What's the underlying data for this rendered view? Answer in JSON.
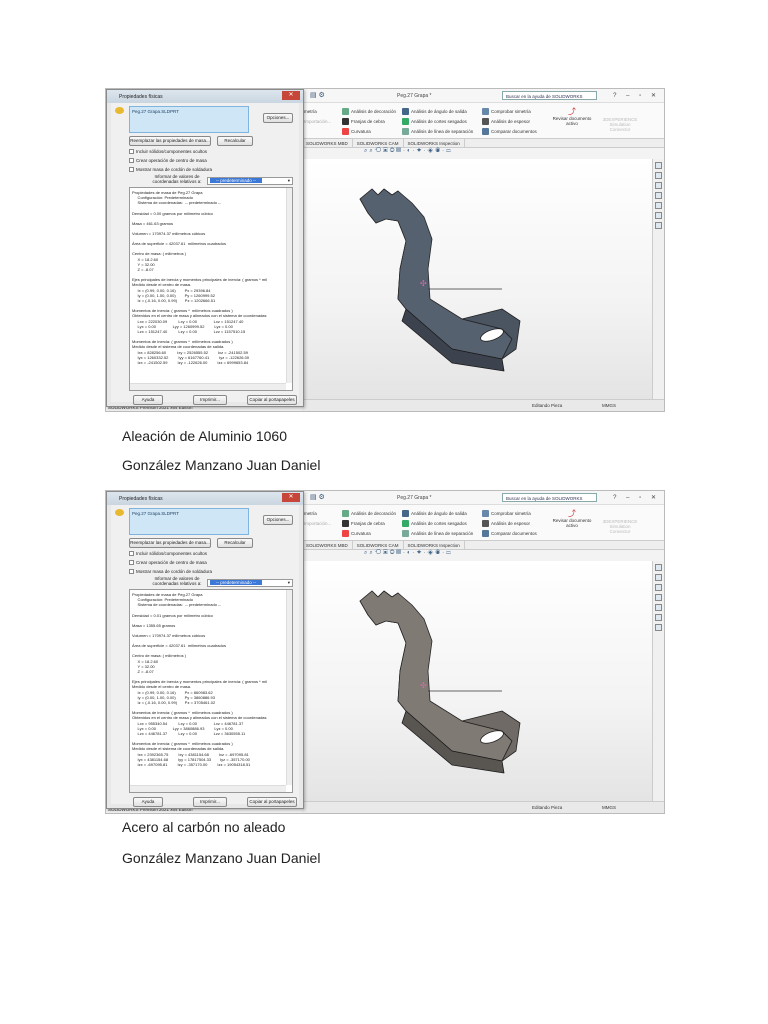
{
  "captions": [
    "Aleación de Aluminio  1060",
    "González Manzano Juan Daniel",
    "Acero al carbón no aleado",
    "González Manzano Juan Daniel"
  ],
  "common": {
    "dialog_title": "Propiedades físicas",
    "selection": "Peg.27 Grapa.SLDPRT",
    "options": "Opciones...",
    "override": "Reemplazar las propiedades de masa...",
    "recalc": "Recalcular",
    "chk_hidden": "Incluir sólidos/componentes ocultos",
    "chk_com": "Crear operación de centro de masa",
    "chk_weld": "Mostrar masa de cordón de soldadura",
    "coord_label": "Informar de valores de coordenadas relativos a:",
    "coord_value": "-- predeterminado --",
    "help": "Ayuda",
    "print": "Imprimir...",
    "copy": "Copiar al portapapeles",
    "doc_title": "Peg.27 Grapa *",
    "search": "Buscar en la ayuda de SOLIDWORKS",
    "ribbon": [
      [
        "Análisis de decoración",
        "Franjas de cebra",
        "Curvatura"
      ],
      [
        "Análisis de ángulo de salida",
        "Análisis de cortes sesgados",
        "Análisis de línea de separación"
      ],
      [
        "Comprobar simetría",
        "Análisis de espesor",
        "Comparar documentos"
      ]
    ],
    "ribbon_left": [
      "metría",
      "Importación..."
    ],
    "review": "Revisar documento activo",
    "simulation": "3DEXPERIENCE Simulation Connector",
    "tabs": [
      "SOLIDWORKS MBD",
      "SOLIDWORKS CAM",
      "SOLIDWORKS Inspection"
    ],
    "taskbar": "SOLIDWORKS Premium 2021 x64 Edition",
    "status_edit": "Editando Pieza",
    "status_units": "MMGS"
  },
  "shots": [
    {
      "report": [
        "Propiedades de masa de Peg.27 Grapa",
        "     Configuración: Predeterminado",
        "     Sistema de coordenadas:  -- predeterminado --",
        "",
        "Densidad = 0.00 gramos por milímetro cúbico",
        "",
        "Masa = 461.63 gramos",
        "",
        "Volumen = 170974.37 milímetros cúbicos",
        "",
        "Área de superficie = 42037.61  milímetros cuadrados",
        "",
        "Centro de masa: ( milímetros )",
        "     X = 18.2.60",
        "     Y = 32.00",
        "     Z = -8.07",
        "",
        "Ejes principales de inercia y momentos principales de inercia: ( gramos * mil",
        "Medido desde el centro de masa.",
        "     Ix = (0.99, 0.00, 0.16)        Px = 29396.84",
        "     Iy = (0.00, 1.00, 0.00)        Py = 1260999.52",
        "     Iz = (-0.16, 0.00, 0.99)       Pz = 1202666.51",
        "",
        "Momentos de inercia: ( gramos *  milímetros cuadrados )",
        "Obtenidos en el centro de masa y alineados con el sistema de coordenadas",
        "     Lxx = 222030.09          Lxy = 0.00               Lxz = 151247.40",
        "     Lyx = 0.00               Lyy = 1260999.52         Lyz = 0.00",
        "     Lzx = 151247.40          Lzy = 0.00               Lzz = 1157510.15",
        "",
        "Momentos de inercia: ( gramos *  milímetros cuadrados )",
        "Medido desde el sistema de coordenadas de salida.",
        "     Ixx = 828256.60          Ixy = 2526555.52         Ixz = -241502.59",
        "     Iyx = 1260332.52         Iyy = 6167760.41         Iyz = -122626.00",
        "     Izx = -241502.59         Izy = -122626.00         Izz = 6999653.84"
      ],
      "part_color": "#4b5461"
    },
    {
      "report": [
        "Propiedades de masa de Peg.27 Grapa",
        "     Configuración: Predeterminado",
        "     Sistema de coordenadas:  -- predeterminado --",
        "",
        "Densidad = 0.01 gramos por milímetro cúbico",
        "",
        "Masa = 1355.65 gramos",
        "",
        "Volumen = 170974.37 milímetros cúbicos",
        "",
        "Área de superficie = 42037.61  milímetros cuadrados",
        "",
        "Centro de masa: ( milímetros )",
        "     X = 18.2.60",
        "     Y = 32.00",
        "     Z = -8.07",
        "",
        "Ejes principales de inercia y momentos principales de inercia: ( gramos * mil",
        "Medido desde el centro de masa.",
        "     Ix = (0.99, 0.00, 0.16)        Px = 860983.62",
        "     Iy = (0.00, 1.00, 0.00)        Py = 3860886.93",
        "     Iz = (-0.16, 0.00, 0.99)       Pz = 3705461.02",
        "",
        "Momentos de inercia: ( gramos *  milímetros cuadrados )",
        "Obtenidos en el centro de masa y alineados con el sistema de coordenadas",
        "     Lxx = 955340.54          Lxy = 0.00               Lxz = 446781.37",
        "     Lyx = 0.00               Lyy = 3860886.93         Lyz = 0.00",
        "     Lzx = 446781.37          Lzy = 0.00               Lzz = 3630555.11",
        "",
        "Momentos de inercia: ( gramos *  milímetros cuadrados )",
        "Medido desde el sistema de coordenadas de salida.",
        "     Ixx = 2392365.75         Ixy = 4381154.68         Ixz = -697095.81",
        "     Iyx = 4381154.68         Iyy = 17817504.33        Iyz = -357170.00",
        "     Izx = -697095.81         Izy = -357170.00         Izz = 19054318.51"
      ],
      "part_color": "#6f6a65"
    }
  ]
}
